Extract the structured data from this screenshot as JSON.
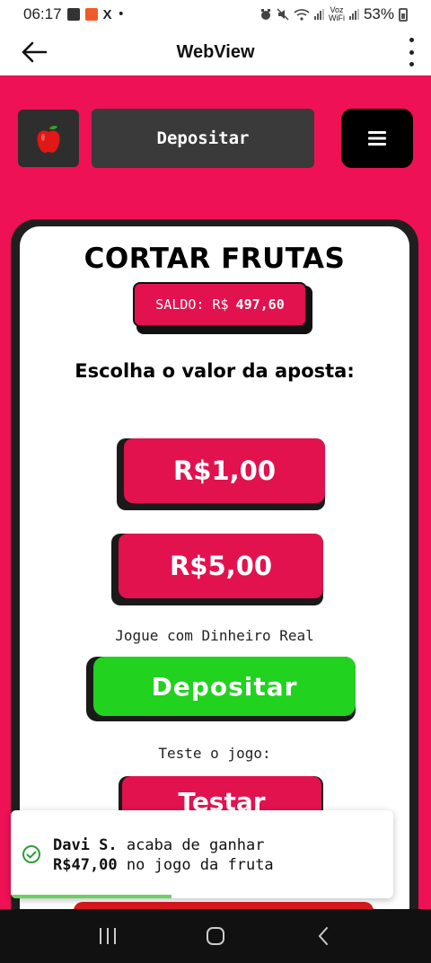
{
  "status_bar": {
    "time": "06:17",
    "x_icon": "X",
    "dot": "•",
    "volte_top": "Voz",
    "volte_bottom": "WiFi",
    "battery": "53%"
  },
  "app_bar": {
    "title": "WebView"
  },
  "header": {
    "deposit_label": "Depositar"
  },
  "game": {
    "title": "CORTAR FRUTAS",
    "balance_label": "SALDO: R$",
    "balance_value": "497,60",
    "prompt": "Escolha o valor da aposta:",
    "bets": [
      "R$1,00",
      "R$5,00"
    ],
    "real_money_label": "Jogue com Dinheiro Real",
    "deposit_button": "Depositar",
    "test_label": "Teste o jogo:",
    "test_button": "Testar"
  },
  "toast": {
    "name": "Davi S.",
    "action": "acaba de ganhar",
    "amount": "R$47,00",
    "suffix": "no jogo da fruta",
    "progress": 0.42
  },
  "colors": {
    "brand": "#ee1155",
    "button_red": "#e2124f",
    "button_green": "#21d21f",
    "toast_progress": "#6ccf63"
  }
}
